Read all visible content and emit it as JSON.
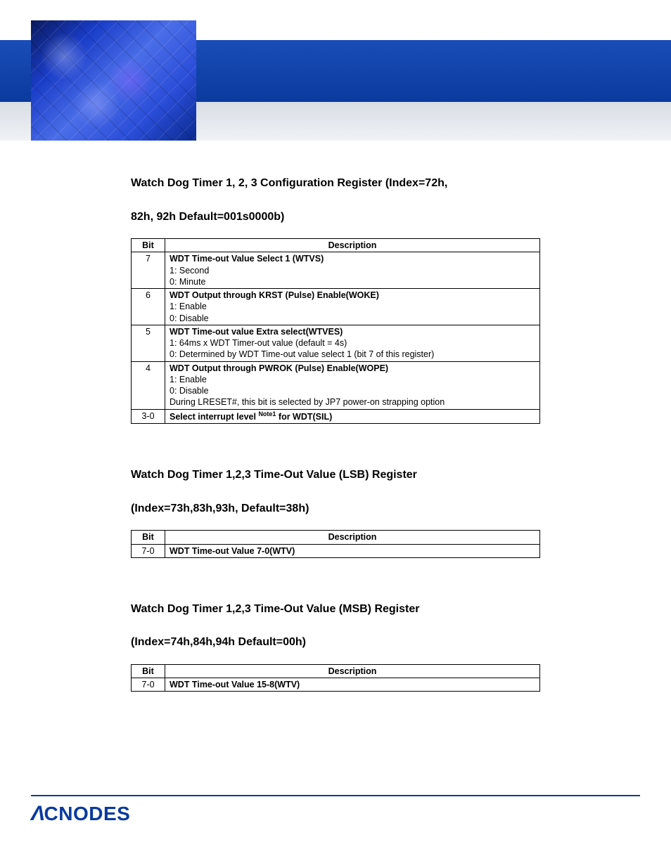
{
  "sections": [
    {
      "title_line1": "Watch Dog Timer 1, 2, 3 Configuration Register (Index=72h,",
      "title_line2": "82h, 92h Default=001s0000b)",
      "headers": {
        "bit": "Bit",
        "desc": "Description"
      },
      "rows": [
        {
          "bit": "7",
          "desc_bold": "WDT Time-out Value Select 1 (WTVS)",
          "lines": [
            "1: Second",
            "0: Minute"
          ]
        },
        {
          "bit": "6",
          "desc_bold": "WDT Output through KRST (Pulse) Enable(WOKE)",
          "lines": [
            "1: Enable",
            "0: Disable"
          ]
        },
        {
          "bit": "5",
          "desc_bold": "WDT Time-out value Extra select(WTVES)",
          "lines": [
            "1: 64ms x WDT Timer-out value (default = 4s)",
            "0: Determined by WDT Time-out value select 1 (bit 7 of this register)"
          ]
        },
        {
          "bit": "4",
          "desc_bold": "WDT Output through PWROK (Pulse) Enable(WOPE)",
          "lines": [
            "1: Enable",
            "0: Disable",
            "During LRESET#, this bit is selected by JP7 power-on strapping option"
          ]
        },
        {
          "bit": "3-0",
          "desc_bold_prefix": "Select interrupt level ",
          "desc_sup": "Note1",
          "desc_bold_suffix": " for WDT(SIL)",
          "lines": []
        }
      ]
    },
    {
      "title_line1": "Watch Dog Timer 1,2,3 Time-Out Value (LSB) Register",
      "title_line2": "(Index=73h,83h,93h, Default=38h)",
      "headers": {
        "bit": "Bit",
        "desc": "Description"
      },
      "rows": [
        {
          "bit": "7-0",
          "desc_bold": "WDT Time-out Value 7-0(WTV)",
          "lines": []
        }
      ]
    },
    {
      "title_line1": "Watch Dog Timer 1,2,3 Time-Out Value (MSB) Register",
      "title_line2": "(Index=74h,84h,94h Default=00h)",
      "headers": {
        "bit": "Bit",
        "desc": "Description"
      },
      "rows": [
        {
          "bit": "7-0",
          "desc_bold": "WDT Time-out Value 15-8(WTV)",
          "lines": []
        }
      ]
    }
  ],
  "logo": {
    "lambda": "Λ",
    "text": "CNODES"
  }
}
